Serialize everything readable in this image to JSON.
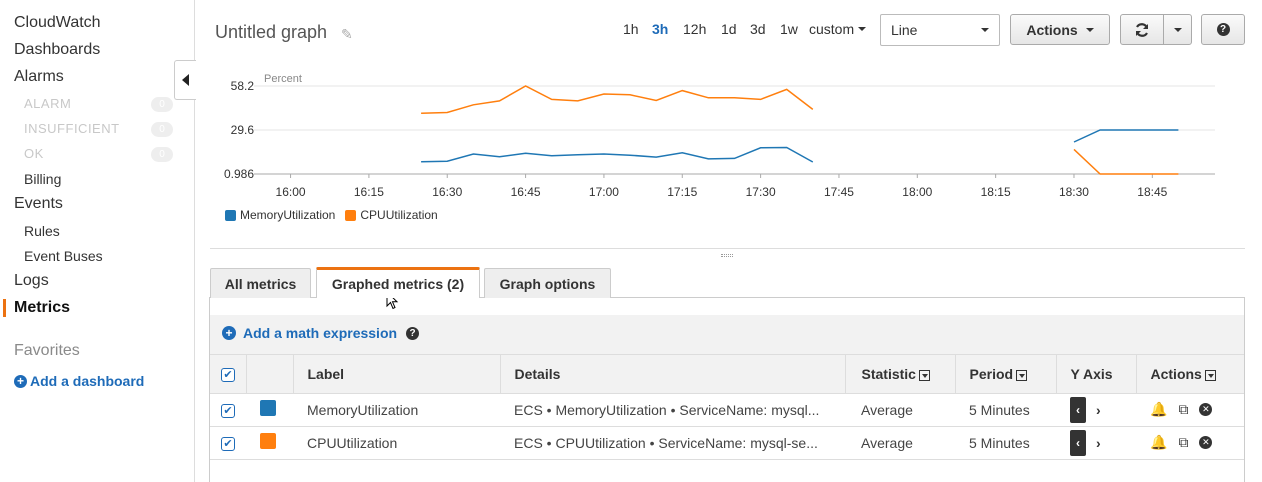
{
  "sidebar": {
    "items": [
      {
        "label": "CloudWatch"
      },
      {
        "label": "Dashboards"
      },
      {
        "label": "Alarms"
      },
      {
        "label": "ALARM",
        "count": "0"
      },
      {
        "label": "INSUFFICIENT",
        "count": "0"
      },
      {
        "label": "OK",
        "count": "0"
      },
      {
        "label": "Billing"
      },
      {
        "label": "Events"
      },
      {
        "label": "Rules"
      },
      {
        "label": "Event Buses"
      },
      {
        "label": "Logs"
      },
      {
        "label": "Metrics"
      }
    ],
    "favorites_title": "Favorites",
    "add_dashboard": "Add a dashboard",
    "accent_color": "#ec7211"
  },
  "header": {
    "title": "Untitled graph",
    "ranges": [
      "1h",
      "3h",
      "12h",
      "1d",
      "3d",
      "1w"
    ],
    "selected_range": "3h",
    "custom_label": "custom",
    "graph_type": "Line",
    "actions_label": "Actions"
  },
  "chart_data": {
    "type": "line",
    "ylabel": "Percent",
    "y_ticks": [
      "58.2",
      "29.6",
      "0.986"
    ],
    "ylim": [
      0.986,
      58.2
    ],
    "x_ticks": [
      "16:00",
      "16:15",
      "16:30",
      "16:45",
      "17:00",
      "17:15",
      "17:30",
      "17:45",
      "18:00",
      "18:15",
      "18:30",
      "18:45"
    ],
    "series": [
      {
        "name": "MemoryUtilization",
        "color": "#1f77b4",
        "segments": [
          [
            [
              "16:25",
              9.0
            ],
            [
              "16:30",
              9.3
            ],
            [
              "16:35",
              14.0
            ],
            [
              "16:40",
              12.2
            ],
            [
              "16:45",
              14.5
            ],
            [
              "16:50",
              12.8
            ],
            [
              "16:55",
              13.5
            ],
            [
              "17:00",
              14.0
            ],
            [
              "17:05",
              13.2
            ],
            [
              "17:10",
              12.0
            ],
            [
              "17:15",
              14.8
            ],
            [
              "17:20",
              10.8
            ],
            [
              "17:25",
              11.1
            ],
            [
              "17:30",
              18.0
            ],
            [
              "17:35",
              18.2
            ],
            [
              "17:40",
              8.8
            ]
          ],
          [
            [
              "18:30",
              21.8
            ],
            [
              "18:35",
              29.6
            ],
            [
              "18:40",
              29.6
            ],
            [
              "18:45",
              29.6
            ],
            [
              "18:50",
              29.6
            ]
          ]
        ]
      },
      {
        "name": "CPUUtilization",
        "color": "#ff7f0e",
        "segments": [
          [
            [
              "16:25",
              40.5
            ],
            [
              "16:30",
              41.0
            ],
            [
              "16:35",
              46.0
            ],
            [
              "16:40",
              48.5
            ],
            [
              "16:45",
              58.2
            ],
            [
              "16:50",
              49.5
            ],
            [
              "16:55",
              48.5
            ],
            [
              "17:00",
              53.0
            ],
            [
              "17:05",
              52.5
            ],
            [
              "17:10",
              48.8
            ],
            [
              "17:15",
              55.2
            ],
            [
              "17:20",
              50.5
            ],
            [
              "17:25",
              50.5
            ],
            [
              "17:30",
              49.5
            ],
            [
              "17:35",
              56.0
            ],
            [
              "17:40",
              43.0
            ]
          ],
          [
            [
              "18:30",
              17.0
            ],
            [
              "18:35",
              0.986
            ],
            [
              "18:40",
              0.986
            ],
            [
              "18:45",
              0.986
            ],
            [
              "18:50",
              0.986
            ]
          ]
        ]
      }
    ]
  },
  "tabs": [
    {
      "label": "All metrics"
    },
    {
      "label": "Graphed metrics (2)"
    },
    {
      "label": "Graph options"
    }
  ],
  "math": {
    "label": "Add a math expression"
  },
  "table": {
    "columns": [
      "Label",
      "Details",
      "Statistic",
      "Period",
      "Y Axis",
      "Actions"
    ],
    "rows": [
      {
        "color": "#1f77b4",
        "label": "MemoryUtilization",
        "details": "ECS • MemoryUtilization • ServiceName: mysql...",
        "statistic": "Average",
        "period": "5 Minutes"
      },
      {
        "color": "#ff7f0e",
        "label": "CPUUtilization",
        "details": "ECS • CPUUtilization • ServiceName: mysql-se...",
        "statistic": "Average",
        "period": "5 Minutes"
      }
    ]
  }
}
